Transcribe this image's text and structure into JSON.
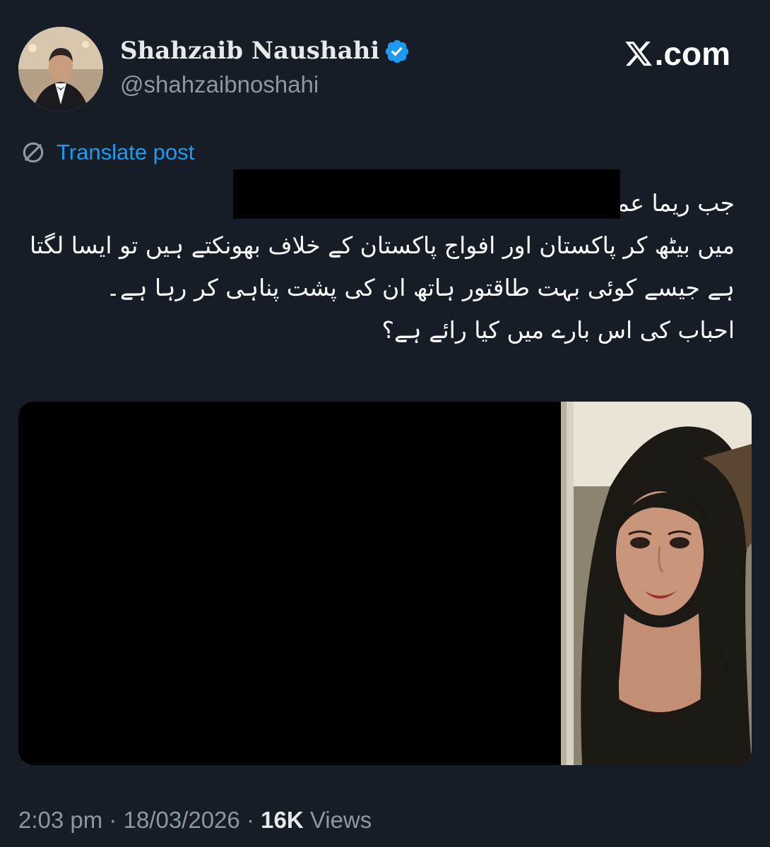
{
  "author": {
    "display_name": "Shahzaib Naushahi",
    "handle": "@shahzaibnoshahi",
    "verified": true
  },
  "brand": {
    "logo_icon": "x-logo-icon",
    "label": ".com"
  },
  "translate": {
    "label": "Translate post",
    "icon": "globe-icon"
  },
  "post": {
    "lines": [
      "جب ریما عمر، جیسے لوگ پاکستان",
      "میں بیٹھ کر پاکستان اور افواج پاکستان کے خلاف بھونکتے ہیں تو ایسا لگتا",
      "ہے جیسے کوئی بہت طاقتور ہاتھ ان کی پشت پناہی کر رہا ہے۔",
      "احباب کی اس بارے میں کیا رائے ہے؟"
    ]
  },
  "meta": {
    "time": "2:03 pm",
    "separator": "·",
    "date": "18/03/2026",
    "views_count": "16K",
    "views_label": "Views"
  },
  "colors": {
    "background": "#161d27",
    "accent": "#1d9bf0",
    "muted": "#8b98a5",
    "text": "#e7e9ea"
  }
}
